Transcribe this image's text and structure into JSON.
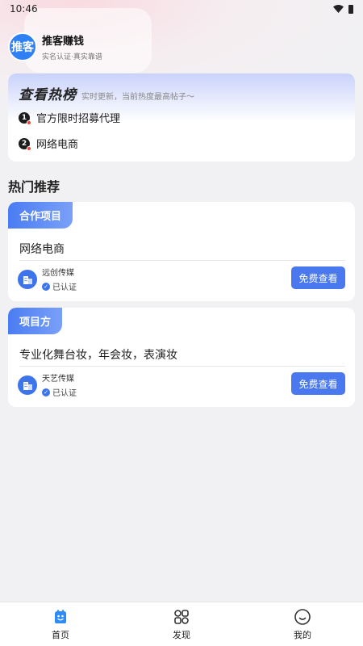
{
  "status_bar": {
    "time": "10:46"
  },
  "app": {
    "logo_text": "推客",
    "title": "推客赚钱",
    "subtitle": "实名认证·真实靠谱"
  },
  "hot_list": {
    "title": "查看热榜",
    "description": "实时更新，当前热度最高帖子～",
    "items": [
      {
        "rank": "1",
        "text": "官方限时招募代理"
      },
      {
        "rank": "2",
        "text": "网络电商"
      }
    ]
  },
  "recommend": {
    "title": "热门推荐",
    "cards": [
      {
        "tag": "合作项目",
        "title": "网络电商",
        "company": "远创传媒",
        "verified": "已认证",
        "button": "免费查看"
      },
      {
        "tag": "项目方",
        "title": "专业化舞台妆，年会妆，表演妆",
        "company": "天艺传媒",
        "verified": "已认证",
        "button": "免费查看"
      }
    ]
  },
  "tab_bar": {
    "items": [
      {
        "label": "首页",
        "icon": "home-icon",
        "active": true
      },
      {
        "label": "发现",
        "icon": "discover-icon",
        "active": false
      },
      {
        "label": "我的",
        "icon": "profile-icon",
        "active": false
      }
    ]
  },
  "colors": {
    "accent": "#4a78ef",
    "active_tab": "#2f8cf5",
    "rank_dot": "#e8453c"
  }
}
